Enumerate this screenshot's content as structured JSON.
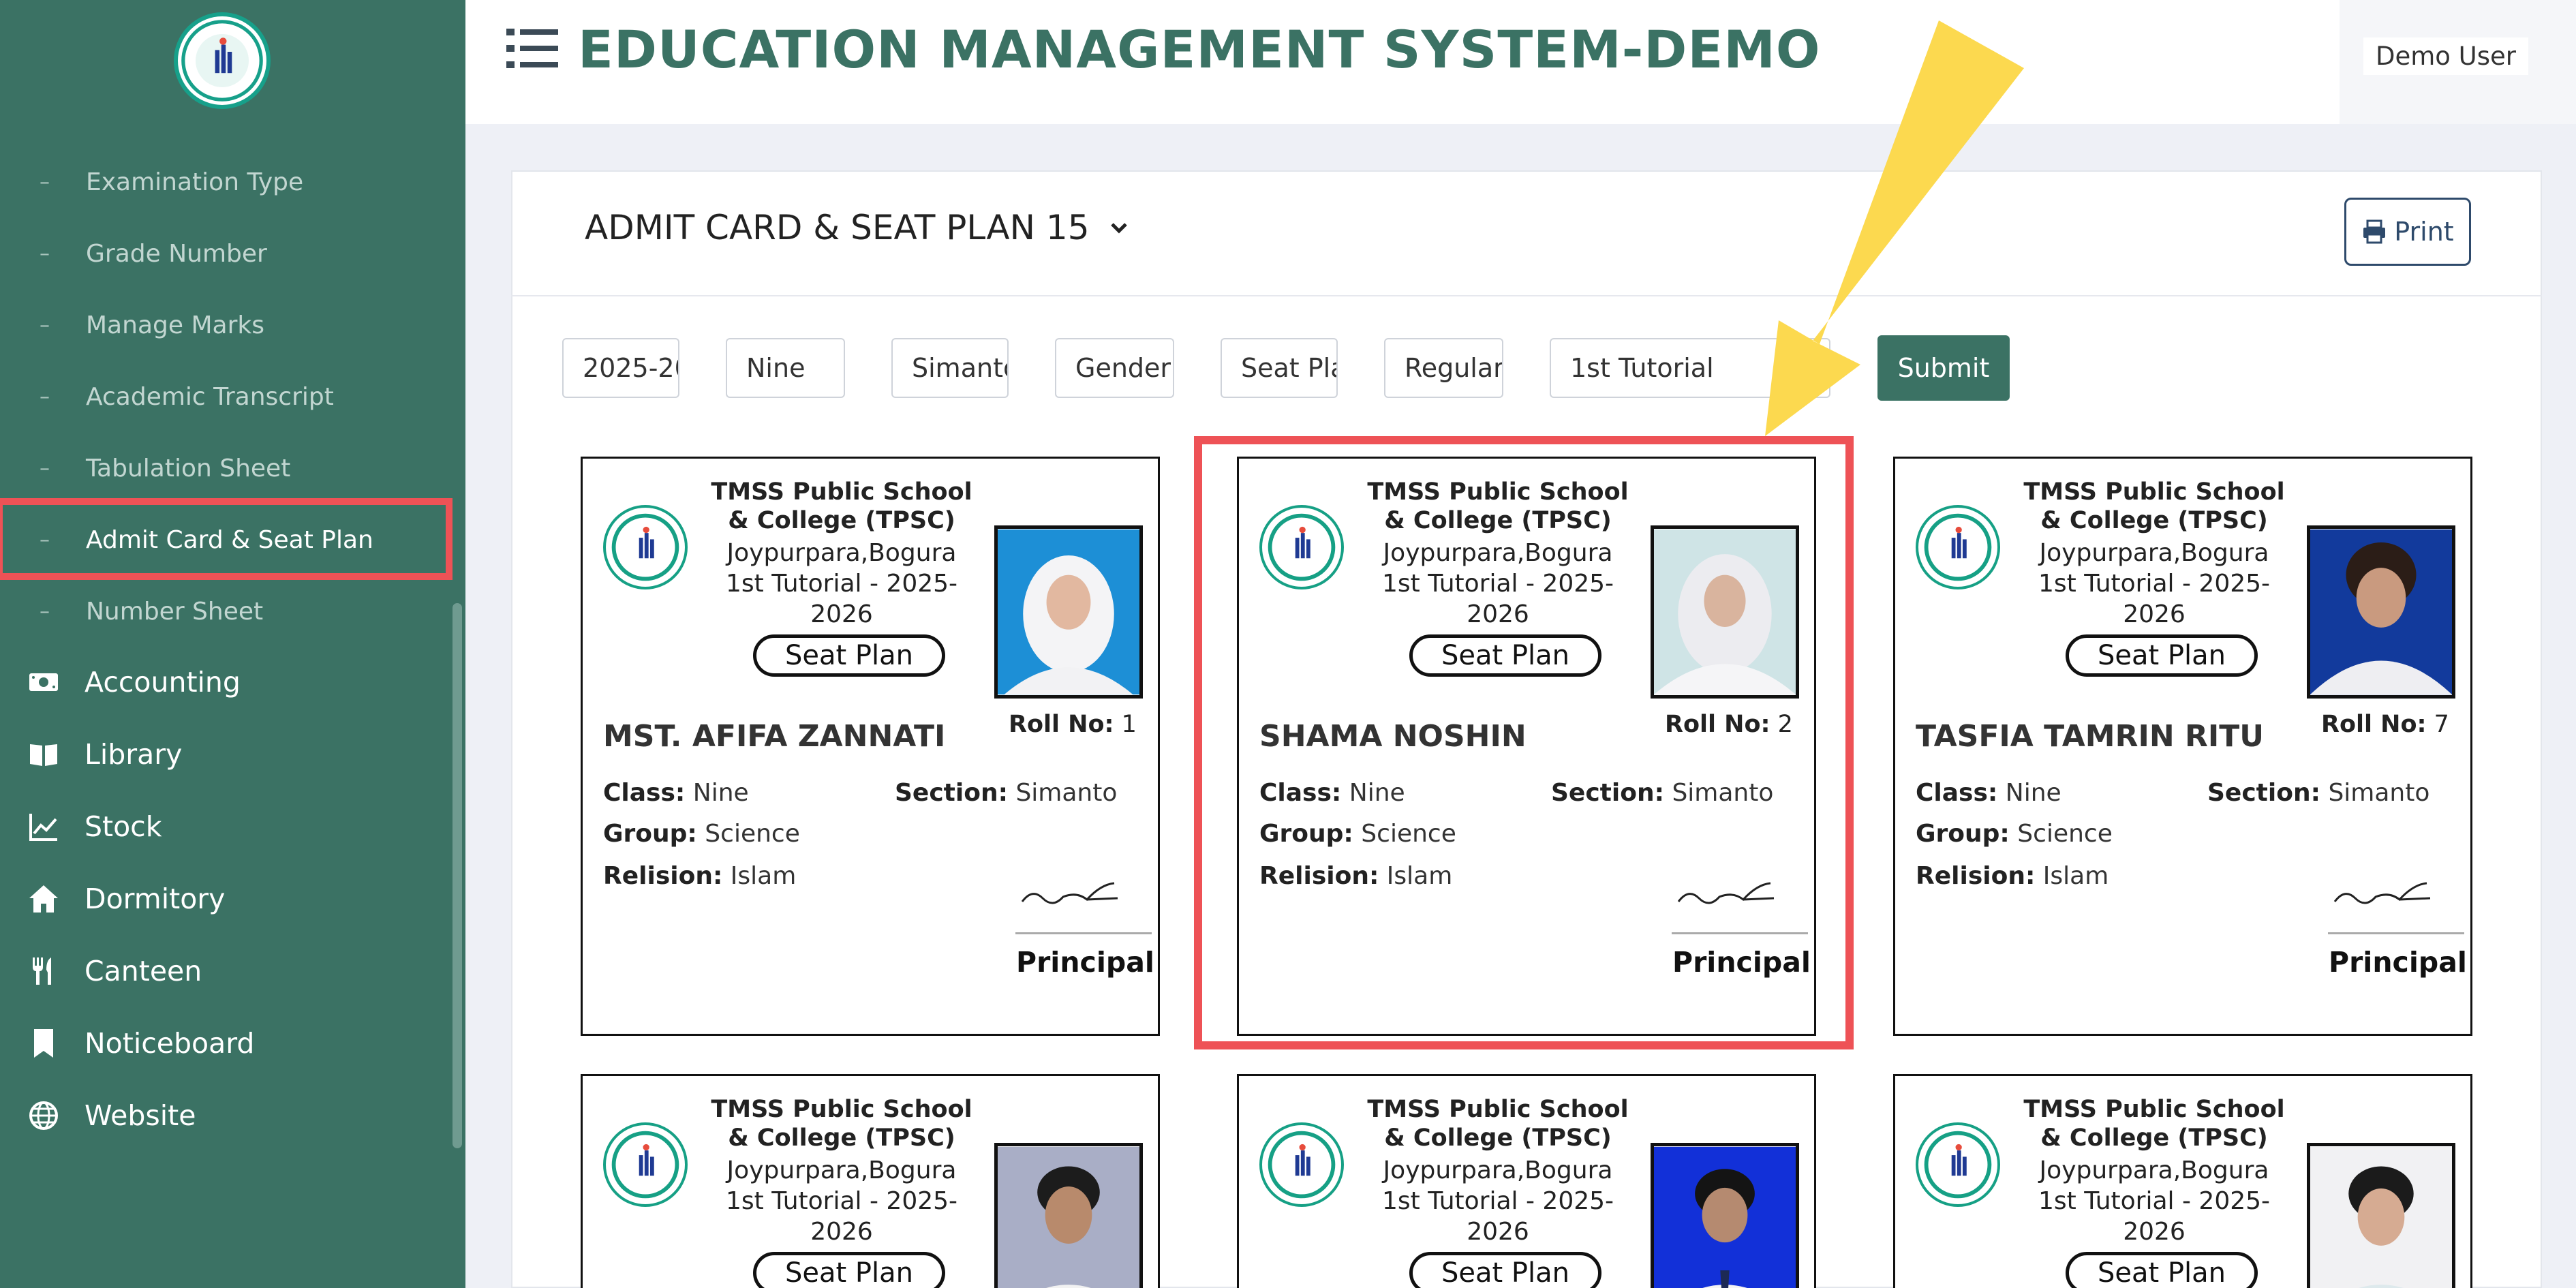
{
  "sidebar": {
    "sub_items": [
      {
        "label": "Examination Type"
      },
      {
        "label": "Grade Number"
      },
      {
        "label": "Manage Marks"
      },
      {
        "label": "Academic Transcript"
      },
      {
        "label": "Tabulation Sheet"
      },
      {
        "label": "Admit Card & Seat Plan",
        "active": true
      },
      {
        "label": "Number Sheet"
      }
    ],
    "main_items": [
      {
        "label": "Accounting",
        "icon": "money-icon"
      },
      {
        "label": "Library",
        "icon": "book-icon"
      },
      {
        "label": "Stock",
        "icon": "chart-line-icon"
      },
      {
        "label": "Dormitory",
        "icon": "home-icon"
      },
      {
        "label": "Canteen",
        "icon": "utensils-icon"
      },
      {
        "label": "Noticeboard",
        "icon": "bookmark-icon"
      },
      {
        "label": "Website",
        "icon": "globe-icon"
      }
    ],
    "bullet": "–"
  },
  "header": {
    "title": "EDUCATION MANAGEMENT SYSTEM-DEMO",
    "user": "Demo User"
  },
  "panel": {
    "title": "ADMIT CARD & SEAT PLAN 15",
    "print_label": "Print"
  },
  "filters": {
    "year": "2025-2026",
    "class": "Nine",
    "section": "Simanto",
    "gender": "Gender",
    "seat": "Seat Plan",
    "type": "Regular",
    "exam": "1st Tutorial",
    "submit_label": "Submit"
  },
  "colors": {
    "sidebar": "#3b7264",
    "accent": "#3b7264",
    "highlight": "#ee5256",
    "arrow": "#fcd94f"
  },
  "card_common": {
    "school": "TMSS Public School & College (TPSC)",
    "address": "Joypurpara,Bogura",
    "exam": "1st Tutorial - 2025-2026",
    "seat_plan": "Seat Plan",
    "roll_label": "Roll No:",
    "class_label": "Class:",
    "section_label": "Section:",
    "group_label": "Group:",
    "religion_label": "Relision:",
    "principal": "Principal"
  },
  "cards": [
    {
      "name": "MST. AFIFA ZANNATI",
      "roll": "1",
      "class": "Nine",
      "section": "Simanto",
      "group": "Science",
      "religion": "Islam"
    },
    {
      "name": "SHAMA NOSHIN",
      "roll": "2",
      "class": "Nine",
      "section": "Simanto",
      "group": "Science",
      "religion": "Islam"
    },
    {
      "name": "TASFIA TAMRIN RITU",
      "roll": "7",
      "class": "Nine",
      "section": "Simanto",
      "group": "Science",
      "religion": "Islam"
    }
  ]
}
